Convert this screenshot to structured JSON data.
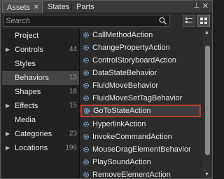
{
  "tabs": [
    {
      "label": "Assets",
      "close": "✕",
      "active": true
    },
    {
      "label": "States",
      "active": false
    },
    {
      "label": "Parts",
      "active": false
    }
  ],
  "window_controls": {
    "pin": "⊥",
    "close": "✕"
  },
  "search": {
    "placeholder": "Search"
  },
  "view_buttons": [
    "list-view-icon",
    "grid-view-icon"
  ],
  "categories": [
    {
      "label": "Project",
      "count": "",
      "expandable": false
    },
    {
      "label": "Controls",
      "count": "44",
      "expandable": true
    },
    {
      "label": "Styles",
      "count": "",
      "expandable": false
    },
    {
      "label": "Behaviors",
      "count": "13",
      "expandable": false,
      "selected": true
    },
    {
      "label": "Shapes",
      "count": "18",
      "expandable": false
    },
    {
      "label": "Effects",
      "count": "15",
      "expandable": true
    },
    {
      "label": "Media",
      "count": "",
      "expandable": false
    },
    {
      "label": "Categories",
      "count": "23",
      "expandable": true
    },
    {
      "label": "Locations",
      "count": "196",
      "expandable": true
    }
  ],
  "items": [
    "CallMethodAction",
    "ChangePropertyAction",
    "ControlStoryboardAction",
    "DataStateBehavior",
    "FluidMoveBehavior",
    "FluidMoveSetTagBehavior",
    "GoToStateAction",
    "HyperlinkAction",
    "InvokeCommandAction",
    "MouseDragElementBehavior",
    "PlaySoundAction",
    "RemoveElementAction"
  ],
  "selected_item": "GoToStateAction",
  "colors": {
    "selection_border": "#c0392b",
    "background": "#2b2b2b"
  }
}
